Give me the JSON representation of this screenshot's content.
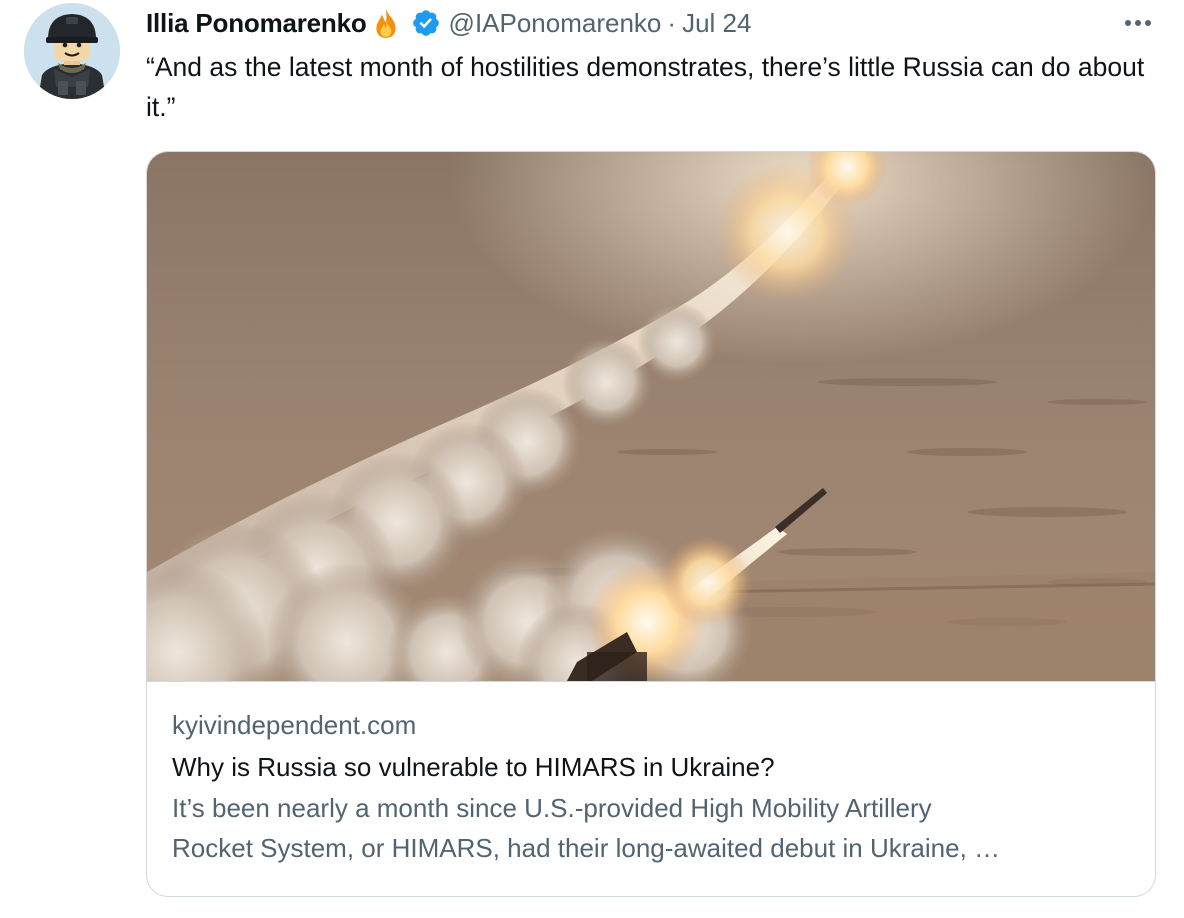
{
  "tweet": {
    "author": {
      "display_name": "Illia Ponomarenko",
      "emoji": "fire-icon",
      "verified": true,
      "handle": "@IAPonomarenko",
      "separator": "·",
      "date": "Jul 24"
    },
    "text": "“And as the latest month of hostilities demonstrates, there’s little Russia can do about it.”",
    "more_menu": "more-options-icon",
    "card": {
      "image_alt": "rocket-launch-photo",
      "domain": "kyivindependent.com",
      "title": "Why is Russia so vulnerable to HIMARS in Ukraine?",
      "description_line1": "It’s been nearly a month since U.S.-provided High Mobility Artillery",
      "description_line2": "Rocket System, or HIMARS, had their long-awaited debut in Ukraine, …"
    }
  },
  "colors": {
    "text_primary": "#0f1419",
    "text_secondary": "#536471",
    "verified_blue": "#1d9bf0",
    "border": "#cfd9de",
    "fire_orange": "#f4900c"
  }
}
